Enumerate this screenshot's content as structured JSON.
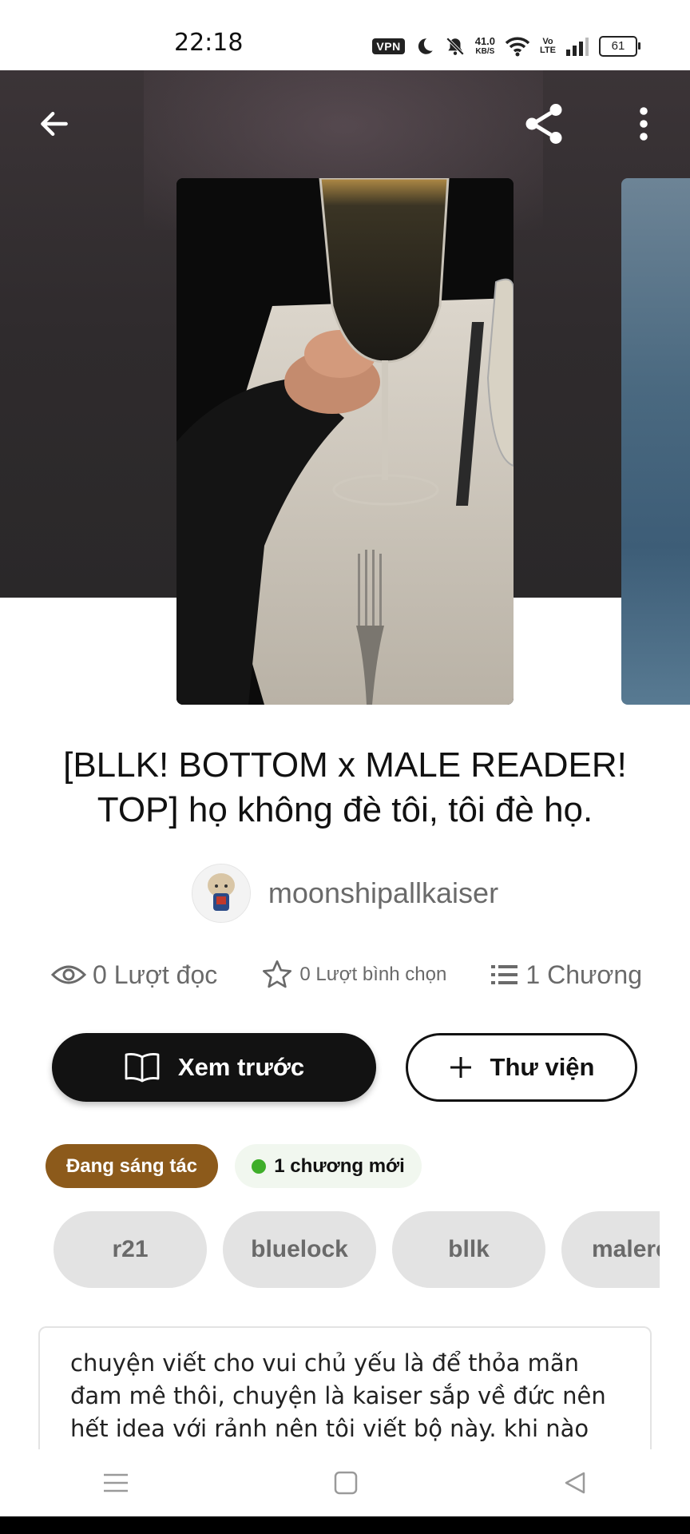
{
  "status_bar": {
    "time": "22:18",
    "vpn": "VPN",
    "speed_value": "41.0",
    "speed_unit": "KB/S",
    "volte_top": "Vo",
    "volte_bottom": "LTE",
    "battery": "61"
  },
  "header": {
    "back_icon": "arrow-left-icon",
    "share_icon": "share-icon",
    "more_icon": "more-vertical-icon"
  },
  "story": {
    "title": "[BLLK! BOTTOM x MALE READER! TOP] họ không đè tôi, tôi đè họ.",
    "author": "moonshipallkaiser",
    "reads": "0 Lượt đọc",
    "votes": "0 Lượt bình chọn",
    "chapters": "1 Chương"
  },
  "actions": {
    "preview_label": "Xem trước",
    "library_label": "Thư viện"
  },
  "badges": {
    "status": "Đang sáng tác",
    "new_chapters": "1 chương mới"
  },
  "tags": [
    "r21",
    "bluelock",
    "bllk",
    "malere"
  ],
  "description": "chuyện viết cho vui chủ yếu là để thỏa mãn đam mê thôi, chuyện là kaiser sắp về đức nên hết idea với rảnh nên tôi viết bộ này. khi nào kaiser về đức",
  "colors": {
    "primary_button": "#121212",
    "status_badge": "#8c5a1b",
    "new_dot": "#3fae2a",
    "tag_bg": "#e3e3e3"
  }
}
